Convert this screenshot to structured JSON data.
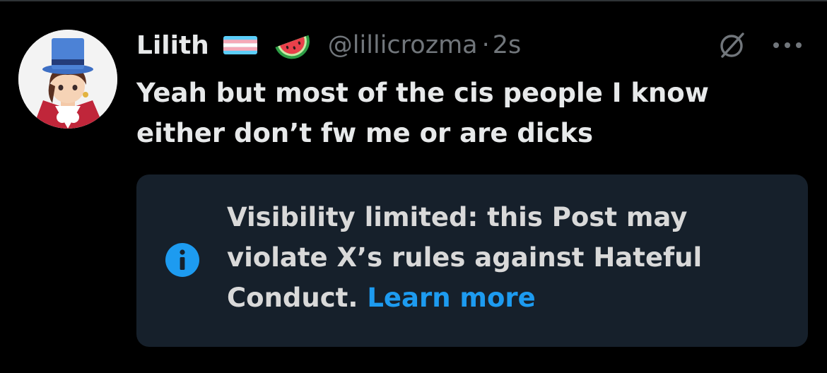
{
  "post": {
    "display_name": "Lilith",
    "handle": "@lillicrozma",
    "separator": "·",
    "timestamp": "2s",
    "text": "Yeah but most of the cis people I know either don’t fw me or are dicks",
    "name_emojis": [
      "transgender-flag-icon",
      "watermelon-icon"
    ]
  },
  "actions": {
    "icons": [
      "grok-icon",
      "more-options-icon"
    ]
  },
  "notice": {
    "message": "Visibility limited: this Post may violate X’s rules against Hateful Conduct.",
    "link_label": "Learn more",
    "icon": "info-icon"
  },
  "colors": {
    "background": "#000000",
    "text": "#e7e9ea",
    "muted": "#71767b",
    "link": "#1d9bf0",
    "notice_bg": "#16202b"
  }
}
